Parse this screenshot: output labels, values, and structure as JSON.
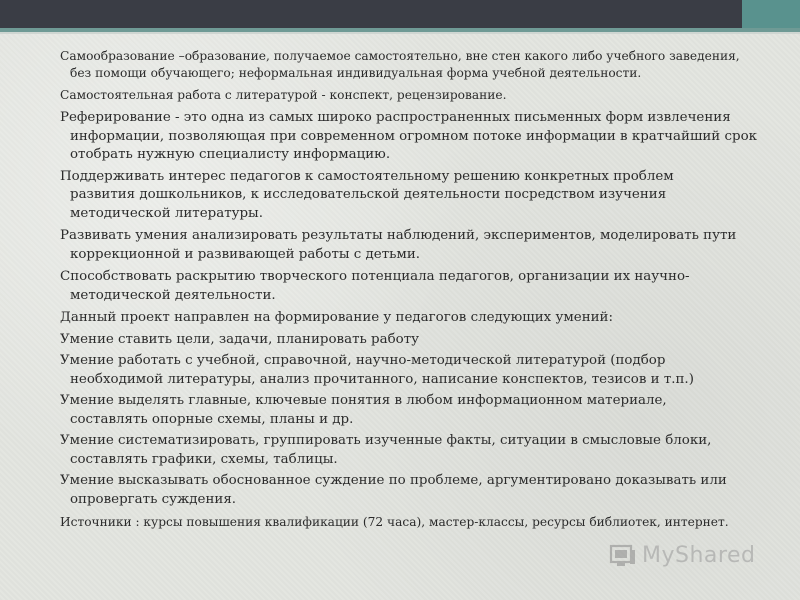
{
  "paragraphs": [
    {
      "first": "Самообразование –образование, получаемое самостоятельно, вне стен какого либо учебного заведения,",
      "rest": "без помощи обучающего; неформальная индивидуальная форма учебной деятельности."
    },
    {
      "first": "Самостоятельная работа с литературой  - конспект, рецензирование.",
      "rest": ""
    },
    {
      "first": "Реферирование  - это одна из самых широко распространенных письменных форм извлечения",
      "rest": "информации, позволяющая при современном огромном потоке информации в кратчайший срок отобрать нужную специалисту информацию."
    },
    {
      "first": "Поддерживать интерес педагогов к самостоятельному решению конкретных проблем",
      "rest": "развития дошкольников, к исследовательской деятельности посредством изучения методической литературы."
    },
    {
      "first": "Развивать умения анализировать результаты наблюдений, экспериментов, моделировать пути",
      "rest": "коррекционной и развивающей работы с детьми."
    },
    {
      "first": "Способствовать раскрытию творческого потенциала педагогов, организации их научно-",
      "rest": "методической деятельности."
    },
    {
      "first": "Данный проект направлен на формирование у педагогов следующих умений:",
      "rest": ""
    },
    {
      "first": "Умение ставить цели, задачи, планировать работу",
      "rest": ""
    },
    {
      "first": "Умение работать с учебной, справочной, научно-методической литературой (подбор",
      "rest": "необходимой литературы, анализ прочитанного, написание конспектов, тезисов и т.п.)"
    },
    {
      "first": "Умение выделять главные, ключевые понятия в любом информационном материале,",
      "rest": "составлять опорные схемы, планы и др."
    },
    {
      "first": "Умение систематизировать, группировать изученные факты, ситуации в смысловые блоки,",
      "rest": "составлять графики, схемы, таблицы."
    },
    {
      "first": "Умение высказывать обоснованное суждение по проблеме, аргументировано доказывать или",
      "rest": "опровергать суждения."
    },
    {
      "first": "Источники : курсы повышения квалификации (72 часа), мастер-классы, ресурсы библиотек, интернет.",
      "rest": ""
    }
  ],
  "watermark": {
    "text": "MyShared"
  },
  "colors": {
    "topbar_dark": "#3a3d45",
    "topbar_teal": "#59928e",
    "text": "#2b2b2b"
  }
}
